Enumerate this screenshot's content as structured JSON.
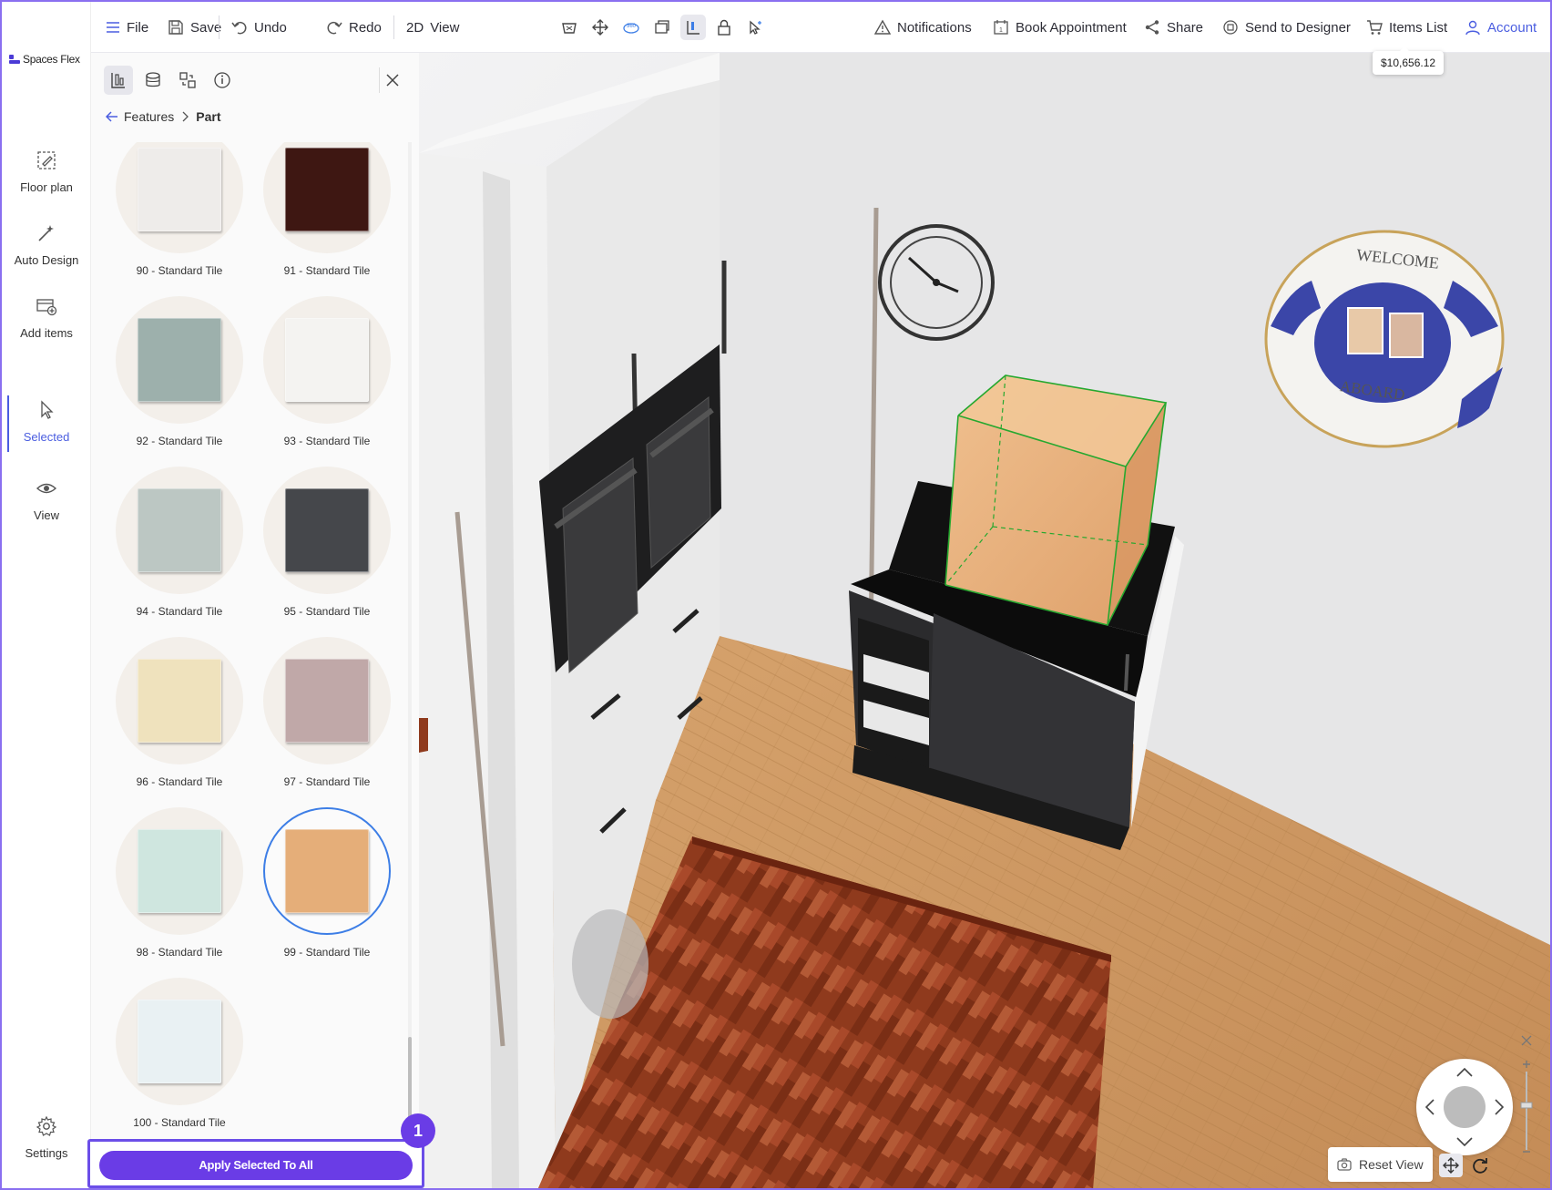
{
  "app": {
    "name": "Spaces Flex"
  },
  "topbar": {
    "file": "File",
    "save": "Save",
    "undo": "Undo",
    "redo": "Redo",
    "view_2d_prefix": "2D",
    "view": "View",
    "notifications": "Notifications",
    "book_appointment": "Book Appointment",
    "share": "Share",
    "send_to_designer": "Send to Designer",
    "items_list": "Items List",
    "account": "Account",
    "total_price": "$10,656.12",
    "tools": [
      "basket-icon",
      "move-arrows-icon",
      "view-360-icon",
      "layers-icon",
      "measure-icon",
      "lock-icon",
      "select-pointer-icon"
    ]
  },
  "rail": {
    "items": [
      {
        "label": "Floor plan",
        "icon": "floor-plan-icon"
      },
      {
        "label": "Auto Design",
        "icon": "magic-wand-icon"
      },
      {
        "label": "Add items",
        "icon": "add-items-icon"
      },
      {
        "label": "Selected",
        "icon": "cursor-icon",
        "active": true
      },
      {
        "label": "View",
        "icon": "eye-icon"
      }
    ],
    "settings": "Settings"
  },
  "panel": {
    "breadcrumb": {
      "parent": "Features",
      "current": "Part"
    },
    "tiles": [
      {
        "label": "90 - Standard Tile",
        "color": "#eeecea"
      },
      {
        "label": "91 - Standard Tile",
        "color": "#3e1712"
      },
      {
        "label": "92 - Standard Tile",
        "color": "#9db0ac"
      },
      {
        "label": "93 - Standard Tile",
        "color": "#f4f3f1"
      },
      {
        "label": "94 - Standard Tile",
        "color": "#bcc7c3"
      },
      {
        "label": "95 - Standard Tile",
        "color": "#45474b"
      },
      {
        "label": "96 - Standard Tile",
        "color": "#efe2bd"
      },
      {
        "label": "97 - Standard Tile",
        "color": "#c0a8a8"
      },
      {
        "label": "98 - Standard Tile",
        "color": "#cfe6df"
      },
      {
        "label": "99 - Standard Tile",
        "color": "#e5ae79",
        "selected": true
      },
      {
        "label": "100 - Standard Tile",
        "color": "#e9f1f3"
      }
    ],
    "apply_button": "Apply Selected To All",
    "step_badge": "1"
  },
  "viewport": {
    "reset_view": "Reset View",
    "wall_sign": {
      "top": "WELCOME",
      "bottom": "ABOARD"
    }
  }
}
